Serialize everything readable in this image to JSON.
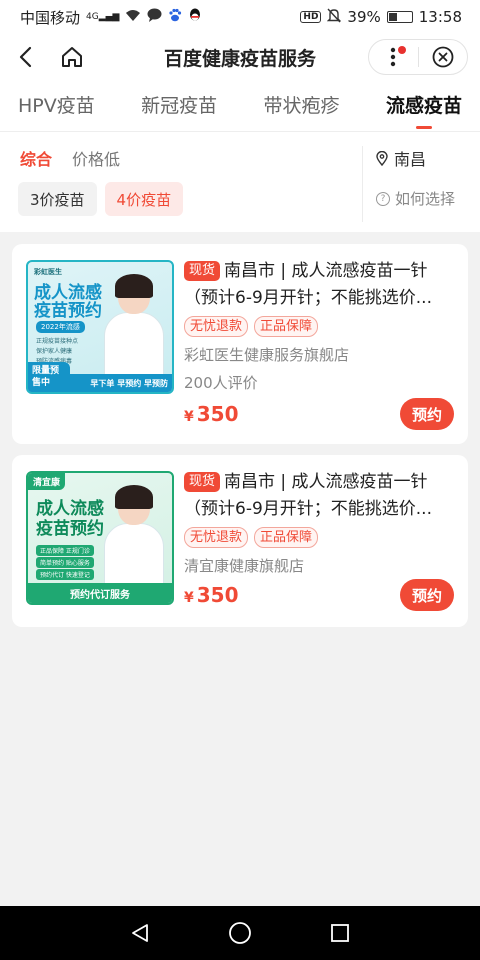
{
  "status_bar": {
    "carrier": "中国移动",
    "network": "4G",
    "battery": "39%",
    "battery_level": 0.39,
    "time": "13:58",
    "hd": "HD"
  },
  "header": {
    "title": "百度健康疫苗服务"
  },
  "tabs": [
    {
      "label": "HPV疫苗",
      "active": false
    },
    {
      "label": "新冠疫苗",
      "active": false
    },
    {
      "label": "带状疱疹",
      "active": false
    },
    {
      "label": "流感疫苗",
      "active": true
    }
  ],
  "filters": {
    "sort": [
      "综合",
      "价格低"
    ],
    "location": "南昌",
    "chips": [
      "3价疫苗",
      "4价疫苗"
    ],
    "how_to_choose": "如何选择"
  },
  "products": [
    {
      "tag": "现货",
      "title_line1": "南昌市 | 成人流感疫苗一针",
      "title_line2": "（预计6-9月开针；不能挑选价...",
      "badges": [
        "无忧退款",
        "正品保障"
      ],
      "shop": "彩虹医生健康服务旗舰店",
      "reviews": "200人评价",
      "currency": "¥",
      "price": "350",
      "book_label": "预约",
      "image": {
        "logo": "彩虹医生",
        "headline": "成人流感疫苗预约",
        "year": "2022年流感",
        "bullets": [
          "正规疫苗接种点",
          "保护家人健康",
          "预防流感病毒"
        ],
        "band": "早下单 早预约 早预防",
        "corner": "限量预售中"
      }
    },
    {
      "tag": "现货",
      "title_line1": "南昌市 | 成人流感疫苗一针",
      "title_line2": "（预计6-9月开针；不能挑选价...",
      "badges": [
        "无忧退款",
        "正品保障"
      ],
      "shop": "清宜康健康旗舰店",
      "currency": "¥",
      "price": "350",
      "book_label": "预约",
      "image": {
        "logo": "清宜康",
        "headline": "成人流感疫苗预约",
        "bullets": [
          "正品保障 正规门诊",
          "简单预约 贴心服务",
          "预约代订 快速登记"
        ],
        "band": "预约代订服务"
      }
    }
  ],
  "colors": {
    "accent": "#f04a36",
    "thumb1": "#25b5c5",
    "thumb2": "#1fa872"
  }
}
